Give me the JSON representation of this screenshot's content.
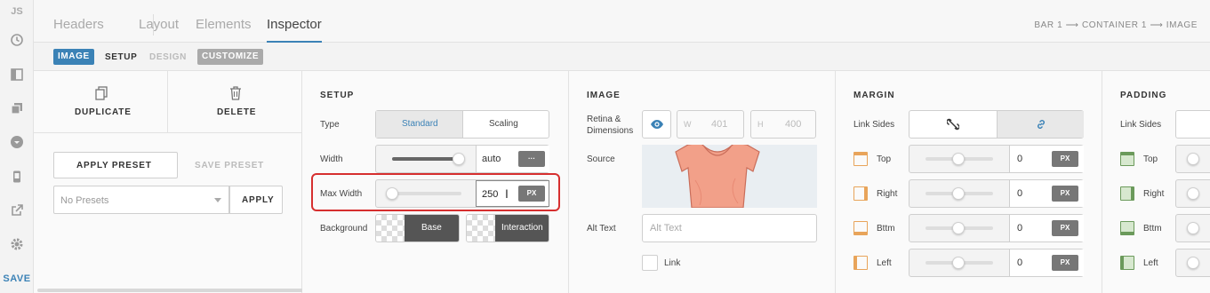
{
  "rail": {
    "js": "JS",
    "save": "SAVE"
  },
  "tabs": {
    "headers": "Headers",
    "layout": "Layout",
    "elements": "Elements",
    "inspector": "Inspector"
  },
  "breadcrumb": "BAR 1 ⟶ CONTAINER 1 ⟶ IMAGE",
  "subtabs": {
    "image": "IMAGE",
    "setup": "SETUP",
    "design": "DESIGN",
    "customize": "CUSTOMIZE"
  },
  "actions": {
    "duplicate": "DUPLICATE",
    "delete": "DELETE",
    "apply_preset": "APPLY PRESET",
    "save_preset": "SAVE PRESET",
    "presets_placeholder": "No Presets",
    "apply": "APPLY"
  },
  "setup": {
    "title": "SETUP",
    "type_label": "Type",
    "type_standard": "Standard",
    "type_scaling": "Scaling",
    "width_label": "Width",
    "width_value": "auto",
    "width_menu": "···",
    "max_width_label": "Max Width",
    "max_width_value": "250",
    "max_width_unit": "PX",
    "background_label": "Background",
    "bg_base": "Base",
    "bg_interaction": "Interaction"
  },
  "image": {
    "title": "IMAGE",
    "retina_label": "Retina & Dimensions",
    "w_label": "W",
    "w_value": "401",
    "h_label": "H",
    "h_value": "400",
    "source_label": "Source",
    "alt_label": "Alt Text",
    "alt_placeholder": "Alt Text",
    "link_label": "Link"
  },
  "margin": {
    "title": "MARGIN",
    "link_sides": "Link Sides",
    "rows": [
      {
        "label": "Top",
        "value": "0",
        "unit": "PX"
      },
      {
        "label": "Right",
        "value": "0",
        "unit": "PX"
      },
      {
        "label": "Bttm",
        "value": "0",
        "unit": "PX"
      },
      {
        "label": "Left",
        "value": "0",
        "unit": "PX"
      }
    ]
  },
  "padding": {
    "title": "PADDING",
    "link_sides": "Link Sides",
    "rows": [
      {
        "label": "Top"
      },
      {
        "label": "Right"
      },
      {
        "label": "Bttm"
      },
      {
        "label": "Left"
      }
    ]
  },
  "colors": {
    "accent": "#3b82b6",
    "highlight": "#d62f2f",
    "margin_icon": "#e8a45a",
    "padding_icon": "#6b9a5b"
  }
}
